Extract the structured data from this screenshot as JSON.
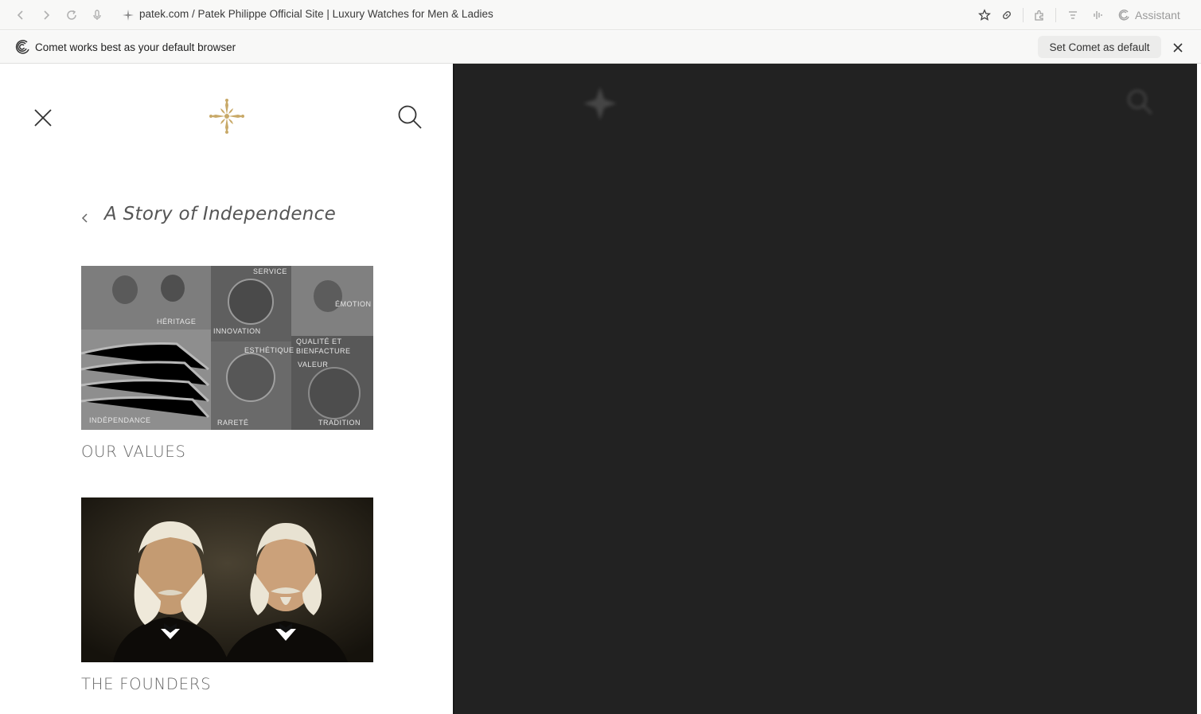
{
  "browser": {
    "url_text": "patek.com / Patek Philippe Official Site | Luxury Watches for Men & Ladies",
    "assistant_label": "Assistant",
    "icons": [
      "back-icon",
      "forward-icon",
      "reload-icon",
      "microphone-icon",
      "bookmark-star-icon",
      "link-icon",
      "extensions-icon",
      "reader-icon",
      "voice-icon",
      "assistant-icon"
    ]
  },
  "infobar": {
    "message": "Comet works best as your default browser",
    "button_label": "Set Comet as default"
  },
  "menu": {
    "section_title": "A Story of Independence",
    "cards": [
      {
        "title": "OUR VALUES",
        "image_words": [
          "HÉRITAGE",
          "SERVICE",
          "ÉMOTION",
          "INNOVATION",
          "ESTHÉTIQUE",
          "QUALITÉ ET",
          "BIENFACTURE",
          "VALEUR",
          "INDÉPENDANCE",
          "RARETÉ",
          "TRADITION"
        ]
      },
      {
        "title": "THE FOUNDERS"
      }
    ]
  },
  "colors": {
    "brand_gold": "#c8a968",
    "overlay_dark": "#222222"
  }
}
